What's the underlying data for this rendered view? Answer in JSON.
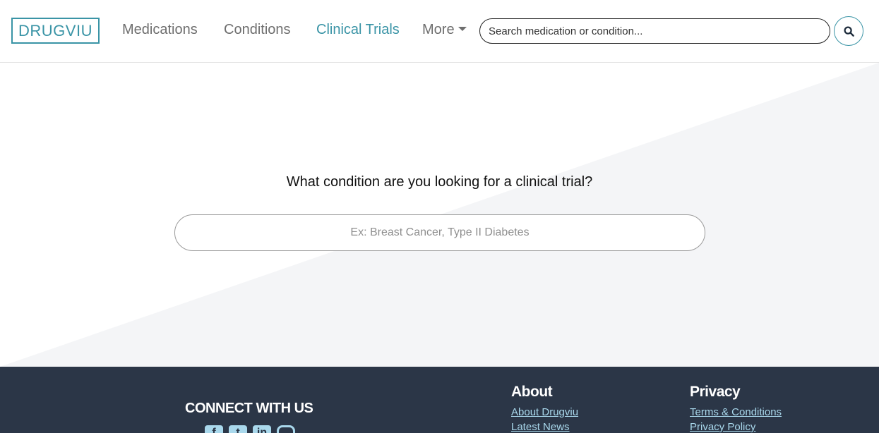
{
  "brand": {
    "logo_text": "DRUGVIU",
    "accent_color": "#3a94a6",
    "footer_bg": "#2b3647",
    "link_color": "#a9d8ec"
  },
  "nav": {
    "items": [
      {
        "label": "Medications"
      },
      {
        "label": "Conditions"
      },
      {
        "label": "Clinical Trials",
        "active": true
      },
      {
        "label": "More"
      }
    ],
    "search": {
      "placeholder": "Search medication or condition...",
      "value": ""
    },
    "search_button_icon": "search-icon"
  },
  "hero": {
    "question": "What condition are you looking for a clinical trial?",
    "input": {
      "placeholder": "Ex: Breast Cancer, Type II Diabetes",
      "value": ""
    }
  },
  "footer": {
    "connect_title": "CONNECT WITH US",
    "social": [
      {
        "icon": "facebook-icon",
        "glyph": "f"
      },
      {
        "icon": "twitter-icon",
        "glyph": "t"
      },
      {
        "icon": "linkedin-icon",
        "glyph": "in"
      },
      {
        "icon": "instagram-icon",
        "glyph": ""
      }
    ],
    "about": {
      "title": "About",
      "links": [
        "About Drugviu",
        "Latest News"
      ]
    },
    "privacy": {
      "title": "Privacy",
      "links": [
        "Terms & Conditions",
        "Privacy Policy"
      ]
    }
  }
}
